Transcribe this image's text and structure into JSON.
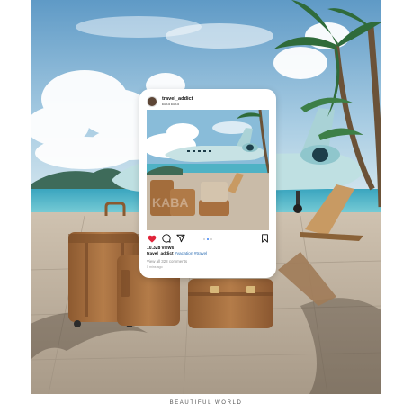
{
  "post": {
    "username": "travel_addict",
    "location": "Bora Bora",
    "likes": "10.328 views",
    "caption_user": "travel_addict",
    "hashtags": "#vacation #travel",
    "comments": "View all 328 comments",
    "time": "5 mins ago",
    "carousel": {
      "count": 3,
      "active_index": 1
    },
    "liked": true
  },
  "footer": {
    "caption": "BEAUTIFUL WORLD"
  },
  "colors": {
    "like_red": "#e0243a",
    "carousel_active": "#3b82f6",
    "sky": "#7fb4d6",
    "sea": "#4fb7c9",
    "jet": "#b9dadd",
    "suitcase": "#a8703f"
  },
  "icons": [
    "heart-icon",
    "comment-icon",
    "share-icon",
    "bookmark-icon"
  ]
}
